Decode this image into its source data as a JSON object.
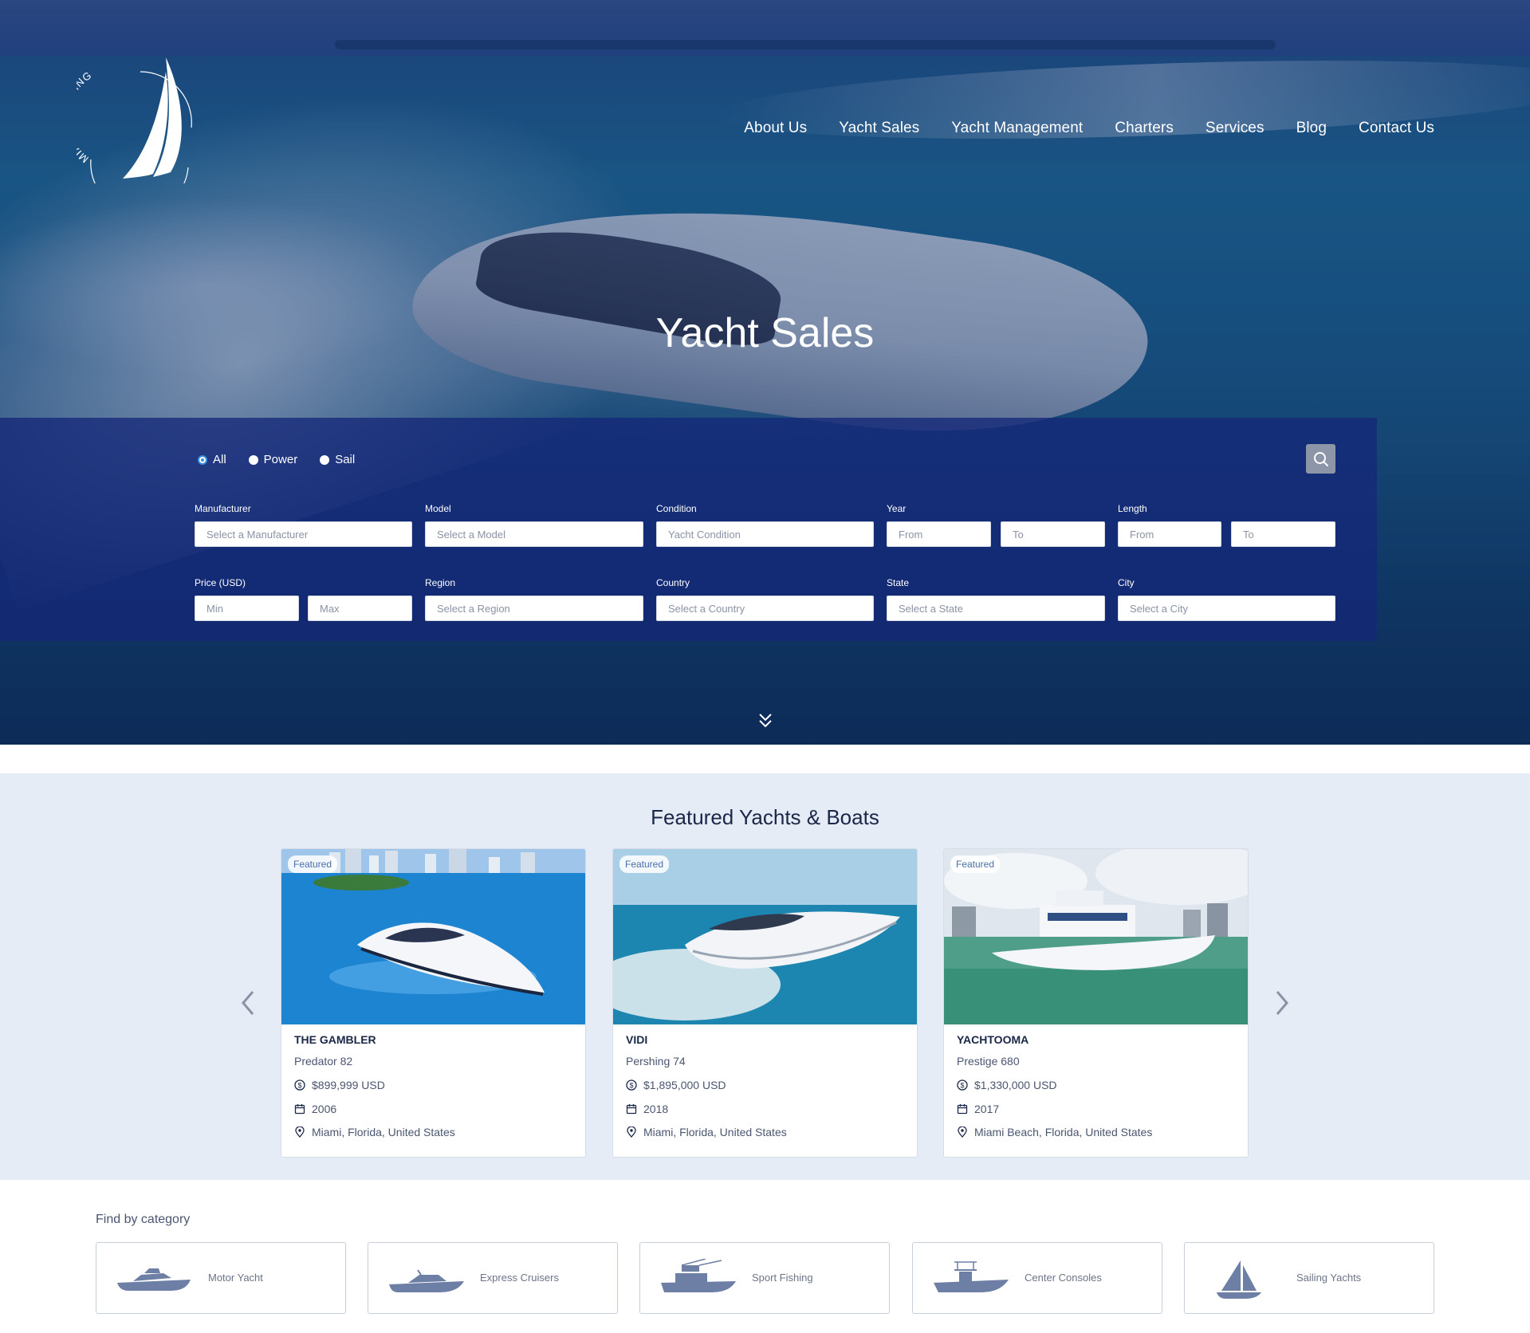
{
  "logo": {
    "text": "MIAMI YACHTING"
  },
  "nav": [
    "About Us",
    "Yacht Sales",
    "Yacht Management",
    "Charters",
    "Services",
    "Blog",
    "Contact Us"
  ],
  "hero": {
    "title": "Yacht Sales"
  },
  "search": {
    "types": [
      {
        "label": "All",
        "checked": true
      },
      {
        "label": "Power",
        "checked": false
      },
      {
        "label": "Sail",
        "checked": false
      }
    ],
    "labels": {
      "manufacturer": "Manufacturer",
      "model": "Model",
      "condition": "Condition",
      "year": "Year",
      "length": "Length",
      "price": "Price (USD)",
      "region": "Region",
      "country": "Country",
      "state": "State",
      "city": "City"
    },
    "placeholders": {
      "manufacturer": "Select a Manufacturer",
      "model": "Select a Model",
      "condition": "Yacht Condition",
      "year_from": "From",
      "year_to": "To",
      "length_from": "From",
      "length_to": "To",
      "price_min": "Min",
      "price_max": "Max",
      "region": "Select a Region",
      "country": "Select a Country",
      "state": "Select a State",
      "city": "Select a City"
    }
  },
  "featured": {
    "title": "Featured Yachts & Boats",
    "badge": "Featured",
    "cards": [
      {
        "name": "THE GAMBLER",
        "model": "Predator 82",
        "price": "$899,999 USD",
        "year": "2006",
        "location": "Miami, Florida, United States"
      },
      {
        "name": "VIDI",
        "model": "Pershing 74",
        "price": "$1,895,000 USD",
        "year": "2018",
        "location": "Miami, Florida, United States"
      },
      {
        "name": "YACHTOOMA",
        "model": "Prestige 680",
        "price": "$1,330,000 USD",
        "year": "2017",
        "location": "Miami Beach, Florida, United States"
      }
    ]
  },
  "categories": {
    "title": "Find by category",
    "items": [
      {
        "label": "Motor Yacht",
        "icon": "motor-yacht-icon"
      },
      {
        "label": "Express Cruisers",
        "icon": "express-cruiser-icon"
      },
      {
        "label": "Sport Fishing",
        "icon": "sport-fishing-icon"
      },
      {
        "label": "Center Consoles",
        "icon": "center-console-icon"
      },
      {
        "label": "Sailing Yachts",
        "icon": "sailboat-icon"
      }
    ]
  },
  "colors": {
    "accent": "#1a2748",
    "panel": "#14287a",
    "featured_bg": "#e6ecf6",
    "icon_fill": "#6e7fa6"
  }
}
